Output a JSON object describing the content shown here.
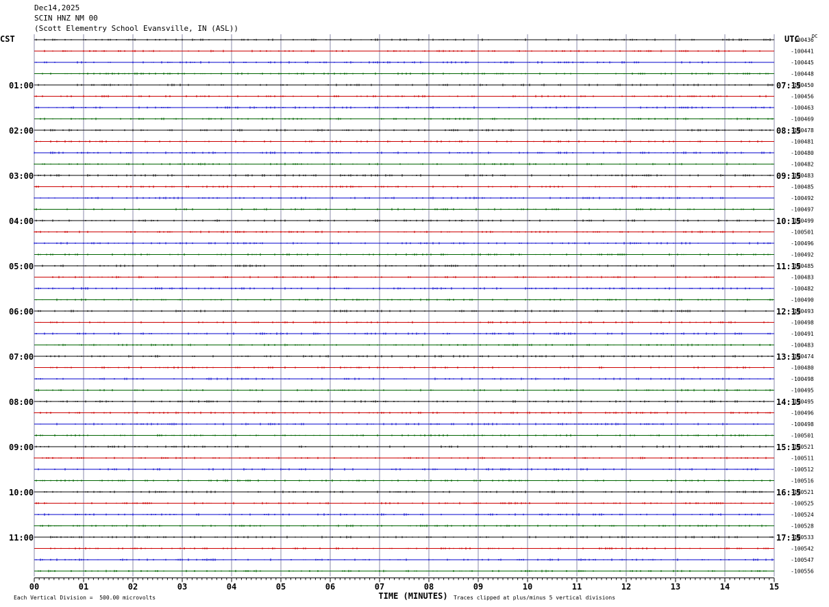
{
  "header": {
    "date": "Dec14,2025",
    "station": "SCIN HNZ NM 00",
    "site": "(Scott Elementry School Evansville, IN (ASL))"
  },
  "labels": {
    "left_tz": "CST",
    "right_tz": "UTC",
    "dc": "DC"
  },
  "footer": {
    "scale": "Each Vertical Division =  500.00 microvolts",
    "clip": "Traces clipped at plus/minus 5 vertical divisions"
  },
  "colors": {
    "trace_cycle": [
      "#000000",
      "#cc0000",
      "#0000cc",
      "#006400"
    ],
    "grid": "#8888aa"
  },
  "chart_data": {
    "type": "line",
    "xlabel": "TIME (MINUTES)",
    "xlim": [
      0,
      15
    ],
    "x_ticks": [
      "00",
      "01",
      "02",
      "03",
      "04",
      "05",
      "06",
      "07",
      "08",
      "09",
      "10",
      "11",
      "12",
      "13",
      "14",
      "15"
    ],
    "left_hour_labels": [
      "01:00",
      "02:00",
      "03:00",
      "04:00",
      "05:00",
      "06:00",
      "07:00",
      "08:00",
      "09:00",
      "10:00",
      "11:00"
    ],
    "right_hour_labels": [
      "07:15",
      "08:15",
      "09:15",
      "10:15",
      "11:15",
      "12:15",
      "13:15",
      "14:15",
      "15:15",
      "16:15",
      "17:15"
    ],
    "traces_per_hour": 4,
    "dc_offsets": [
      "-100436",
      "-100441",
      "-100445",
      "-100448",
      "-100450",
      "-100456",
      "-100463",
      "-100469",
      "-100478",
      "-100481",
      "-100480",
      "-100482",
      "-100483",
      "-100485",
      "-100492",
      "-100497",
      "-100499",
      "-100501",
      "-100496",
      "-100492",
      "-100485",
      "-100483",
      "-100482",
      "-100490",
      "-100493",
      "-100498",
      "-100491",
      "-100483",
      "-100474",
      "-100480",
      "-100498",
      "-100495",
      "-100495",
      "-100496",
      "-100498",
      "-100501",
      "-100521",
      "-100511",
      "-100512",
      "-100516",
      "-100521",
      "-100525",
      "-100524",
      "-100528",
      "-100533",
      "-100542",
      "-100547",
      "-100556"
    ]
  }
}
